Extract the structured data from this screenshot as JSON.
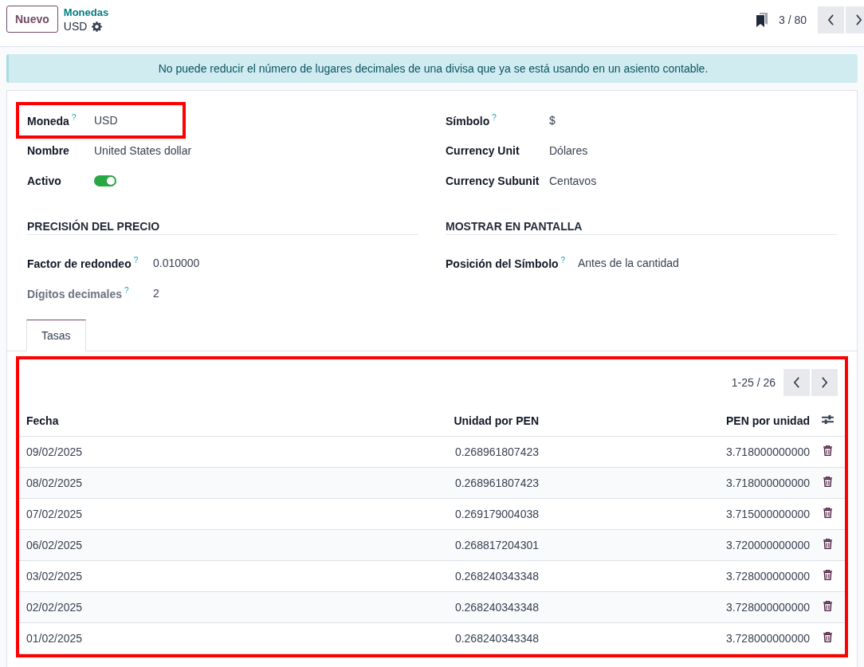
{
  "control_panel": {
    "new_button": "Nuevo",
    "breadcrumb": "Monedas",
    "record_title": "USD",
    "pager": "3 / 80"
  },
  "alert": "No puede reducir el número de lugares decimales de una divisa que ya se está usando en un asiento contable.",
  "fields_left": [
    {
      "label": "Moneda",
      "help": "?",
      "value": "USD",
      "highlighted": true,
      "kind": "text"
    },
    {
      "label": "Nombre",
      "value": "United States dollar",
      "highlighted": false,
      "kind": "text"
    },
    {
      "label": "Activo",
      "on": true,
      "highlighted": false,
      "kind": "toggle"
    }
  ],
  "fields_right": [
    {
      "label": "Símbolo",
      "help": "?",
      "value": "$",
      "kind": "text"
    },
    {
      "label": "Currency Unit",
      "value": "Dólares",
      "kind": "text"
    },
    {
      "label": "Currency Subunit",
      "value": "Centavos",
      "kind": "text"
    }
  ],
  "sections": [
    {
      "title": "PRECISIÓN DEL PRECIO",
      "fields": [
        {
          "label": "Factor de redondeo",
          "help": "?",
          "value": "0.010000",
          "muted": false
        },
        {
          "label": "Dígitos decimales",
          "help": "?",
          "value": "2",
          "muted": true
        }
      ]
    },
    {
      "title": "MOSTRAR EN PANTALLA",
      "fields": [
        {
          "label": "Posición del Símbolo",
          "help": "?",
          "value": "Antes de la cantidad",
          "muted": false
        }
      ]
    }
  ],
  "tabs": [
    {
      "label": "Tasas",
      "selected": true
    }
  ],
  "rates": {
    "highlighted": true,
    "pager": "1-25 / 26",
    "columns": [
      "Fecha",
      "Unidad por PEN",
      "PEN por unidad"
    ],
    "rows": [
      {
        "date": "09/02/2025",
        "unit_per_pen": "0.268961807423",
        "pen_per_unit": "3.718000000000"
      },
      {
        "date": "08/02/2025",
        "unit_per_pen": "0.268961807423",
        "pen_per_unit": "3.718000000000"
      },
      {
        "date": "07/02/2025",
        "unit_per_pen": "0.269179004038",
        "pen_per_unit": "3.715000000000"
      },
      {
        "date": "06/02/2025",
        "unit_per_pen": "0.268817204301",
        "pen_per_unit": "3.720000000000"
      },
      {
        "date": "03/02/2025",
        "unit_per_pen": "0.268240343348",
        "pen_per_unit": "3.728000000000"
      },
      {
        "date": "02/02/2025",
        "unit_per_pen": "0.268240343348",
        "pen_per_unit": "3.728000000000"
      },
      {
        "date": "01/02/2025",
        "unit_per_pen": "0.268240343348",
        "pen_per_unit": "3.728000000000"
      }
    ]
  }
}
